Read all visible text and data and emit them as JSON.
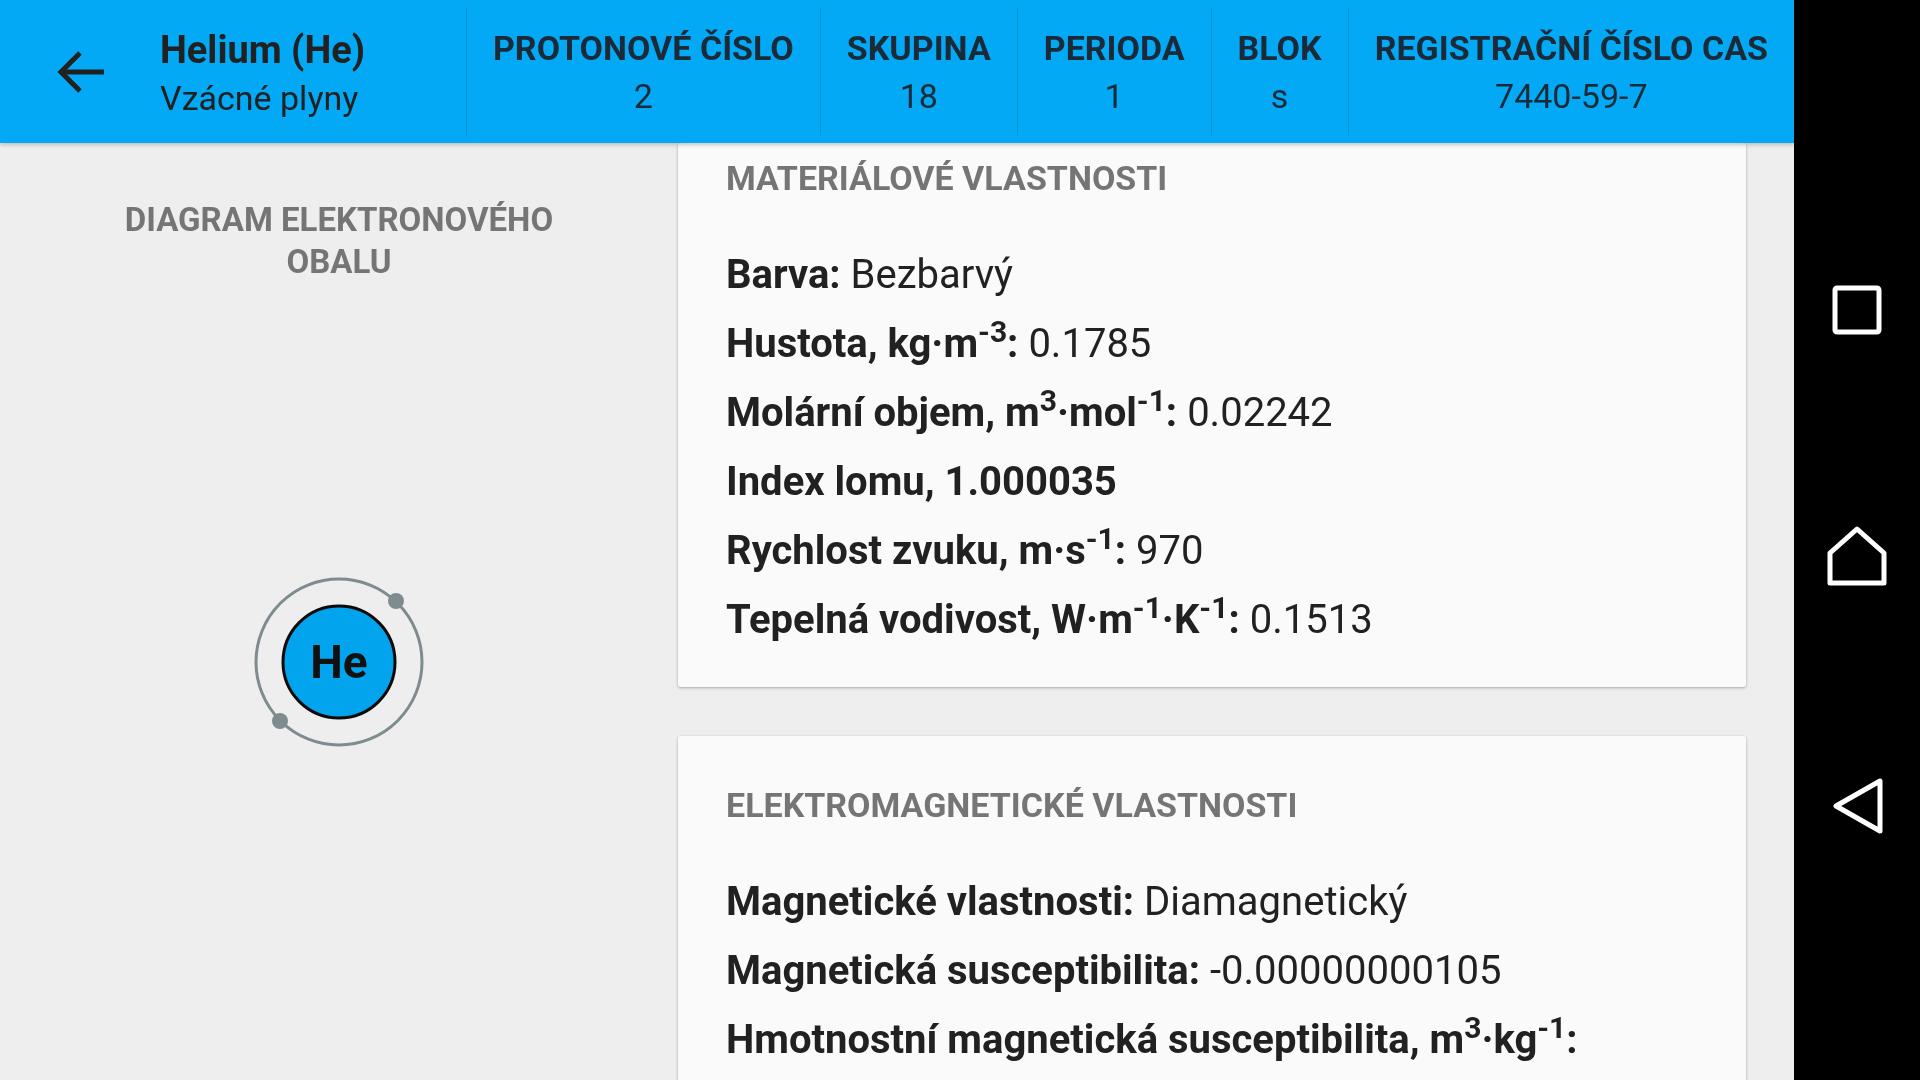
{
  "app_bar": {
    "title": "Helium (He)",
    "subtitle": "Vzácné plyny",
    "properties": [
      {
        "label": "PROTONOVÉ ČÍSLO",
        "value": "2"
      },
      {
        "label": "SKUPINA",
        "value": "18"
      },
      {
        "label": "PERIODA",
        "value": "1"
      },
      {
        "label": "BLOK",
        "value": "s"
      },
      {
        "label": "REGISTRAČNÍ ČÍSLO CAS",
        "value": "7440-59-7"
      }
    ]
  },
  "diagram": {
    "title": "DIAGRAM ELEKTRONOVÉHO OBALU",
    "symbol": "He"
  },
  "cards": [
    {
      "title": "MATERIÁLOVÉ VLASTNOSTI",
      "rows": [
        {
          "label": "Barva:",
          "value": "Bezbarvý"
        },
        {
          "label": "Hustota, kg·m$^{-3}$:",
          "value": "0.1785"
        },
        {
          "label": "Molární objem, m$^{3}$·mol$^{-1}$:",
          "value": "0.02242"
        },
        {
          "label": "Index lomu, 1.000035"
        },
        {
          "label": "Rychlost zvuku, m·s$^{-1}$:",
          "value": "970"
        },
        {
          "label": "Tepelná vodivost, W·m$^{-1}$·K$^{-1}$:",
          "value": "0.1513"
        }
      ]
    },
    {
      "title": "ELEKTROMAGNETICKÉ VLASTNOSTI",
      "rows": [
        {
          "label": "Magnetické vlastnosti:",
          "value": "Diamagnetický"
        },
        {
          "label": "Magnetická susceptibilita:",
          "value": "-0.00000000105"
        },
        {
          "label": "Hmotnostní magnetická susceptibilita, m$^{3}$·kg$^{-1}$:"
        }
      ]
    }
  ]
}
